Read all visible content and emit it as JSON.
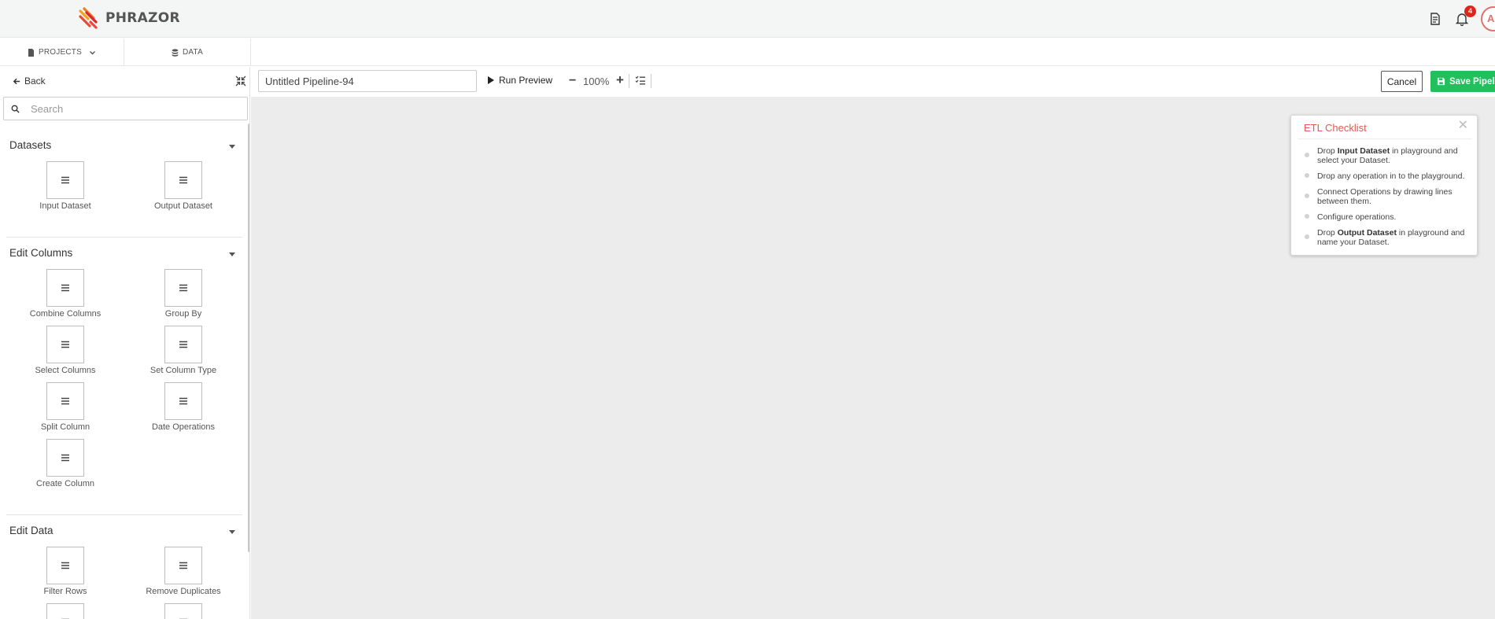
{
  "brand": {
    "name": "PHRAZOR"
  },
  "topbar": {
    "notification_count": "4",
    "avatar_initials": "AI"
  },
  "nav": {
    "projects": "PROJECTS",
    "data": "DATA"
  },
  "panel": {
    "back": "Back",
    "search_placeholder": "Search",
    "sections": [
      {
        "title": "Datasets",
        "items": [
          "Input Dataset",
          "Output Dataset"
        ]
      },
      {
        "title": "Edit Columns",
        "items": [
          "Combine Columns",
          "Group By",
          "Select Columns",
          "Set Column Type",
          "Split Column",
          "Date Operations",
          "Create Column"
        ]
      },
      {
        "title": "Edit Data",
        "items": [
          "Filter Rows",
          "Remove Duplicates"
        ]
      }
    ]
  },
  "toolbar": {
    "pipeline_name": "Untitled Pipeline-94",
    "run_preview": "Run Preview",
    "zoom": "100%",
    "cancel": "Cancel",
    "save": "Save Pipeline"
  },
  "checklist": {
    "title": "ETL Checklist",
    "items": [
      {
        "pre": "Drop ",
        "bold": "Input Dataset",
        "post": " in playground and select your Dataset."
      },
      {
        "pre": "Drop any operation in to the playground.",
        "bold": "",
        "post": ""
      },
      {
        "pre": "Connect Operations by drawing lines between them.",
        "bold": "",
        "post": ""
      },
      {
        "pre": "Configure operations.",
        "bold": "",
        "post": ""
      },
      {
        "pre": "Drop ",
        "bold": "Output Dataset",
        "post": " in playground and name your Dataset."
      }
    ]
  },
  "colors": {
    "accent": "#e25a52",
    "save_green": "#22c05d",
    "badge_red": "#e0241b",
    "canvas_bg": "#ececec"
  }
}
